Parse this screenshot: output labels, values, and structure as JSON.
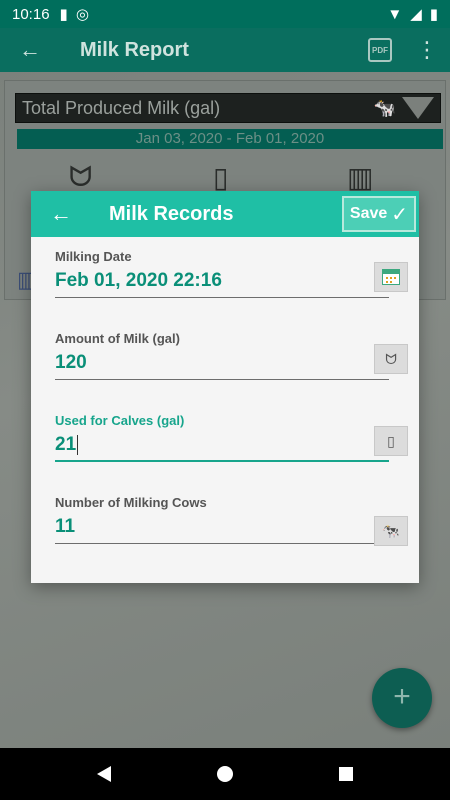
{
  "status_bar": {
    "time": "10:16"
  },
  "app_bar": {
    "title": "Milk Report",
    "pdf_label": "PDF"
  },
  "background": {
    "selector_value": "Total Produced Milk (gal)",
    "date_range": "Jan 03, 2020 - Feb 01, 2020"
  },
  "dialog": {
    "title": "Milk Records",
    "save_label": "Save",
    "fields": [
      {
        "label": "Milking Date",
        "value": "Feb 01, 2020 22:16",
        "icon": "calendar-icon"
      },
      {
        "label": "Amount of Milk (gal)",
        "value": "120",
        "icon": "udder-icon"
      },
      {
        "label": "Used for Calves (gal)",
        "value": "21",
        "icon": "baby-bottle-icon"
      },
      {
        "label": "Number of Milking Cows",
        "value": "11",
        "icon": "cow-icon"
      }
    ]
  },
  "colors": {
    "accent": "#1fbfa5",
    "accent_dark": "#006e5c",
    "value_text": "#0a8f78"
  }
}
